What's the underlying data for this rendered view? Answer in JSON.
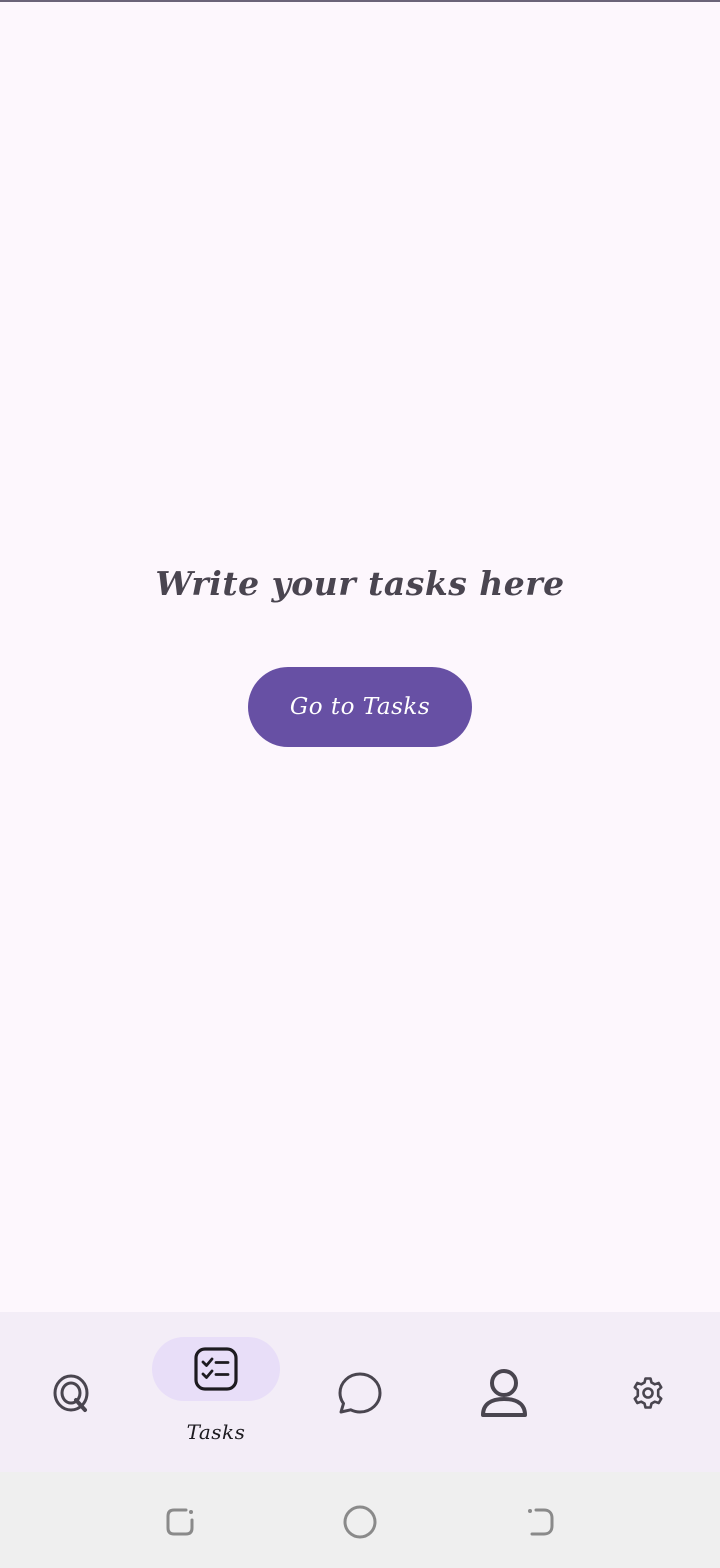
{
  "main": {
    "headline": "Write your tasks here",
    "cta_label": "Go to Tasks"
  },
  "bottom_nav": {
    "items": [
      {
        "icon": "quote-q-icon",
        "label": "",
        "active": false
      },
      {
        "icon": "checklist-icon",
        "label": "Tasks",
        "active": true
      },
      {
        "icon": "chat-bubble-icon",
        "label": "",
        "active": false
      },
      {
        "icon": "person-icon",
        "label": "",
        "active": false
      },
      {
        "icon": "gear-icon",
        "label": "",
        "active": false
      }
    ]
  },
  "system_nav": {
    "buttons": [
      "recent-apps-icon",
      "home-icon",
      "back-icon"
    ]
  },
  "colors": {
    "background": "#fdf7fd",
    "primary": "#6750a4",
    "nav_background": "#f3edf7",
    "active_indicator": "#e8def8",
    "text": "#4a4550"
  }
}
